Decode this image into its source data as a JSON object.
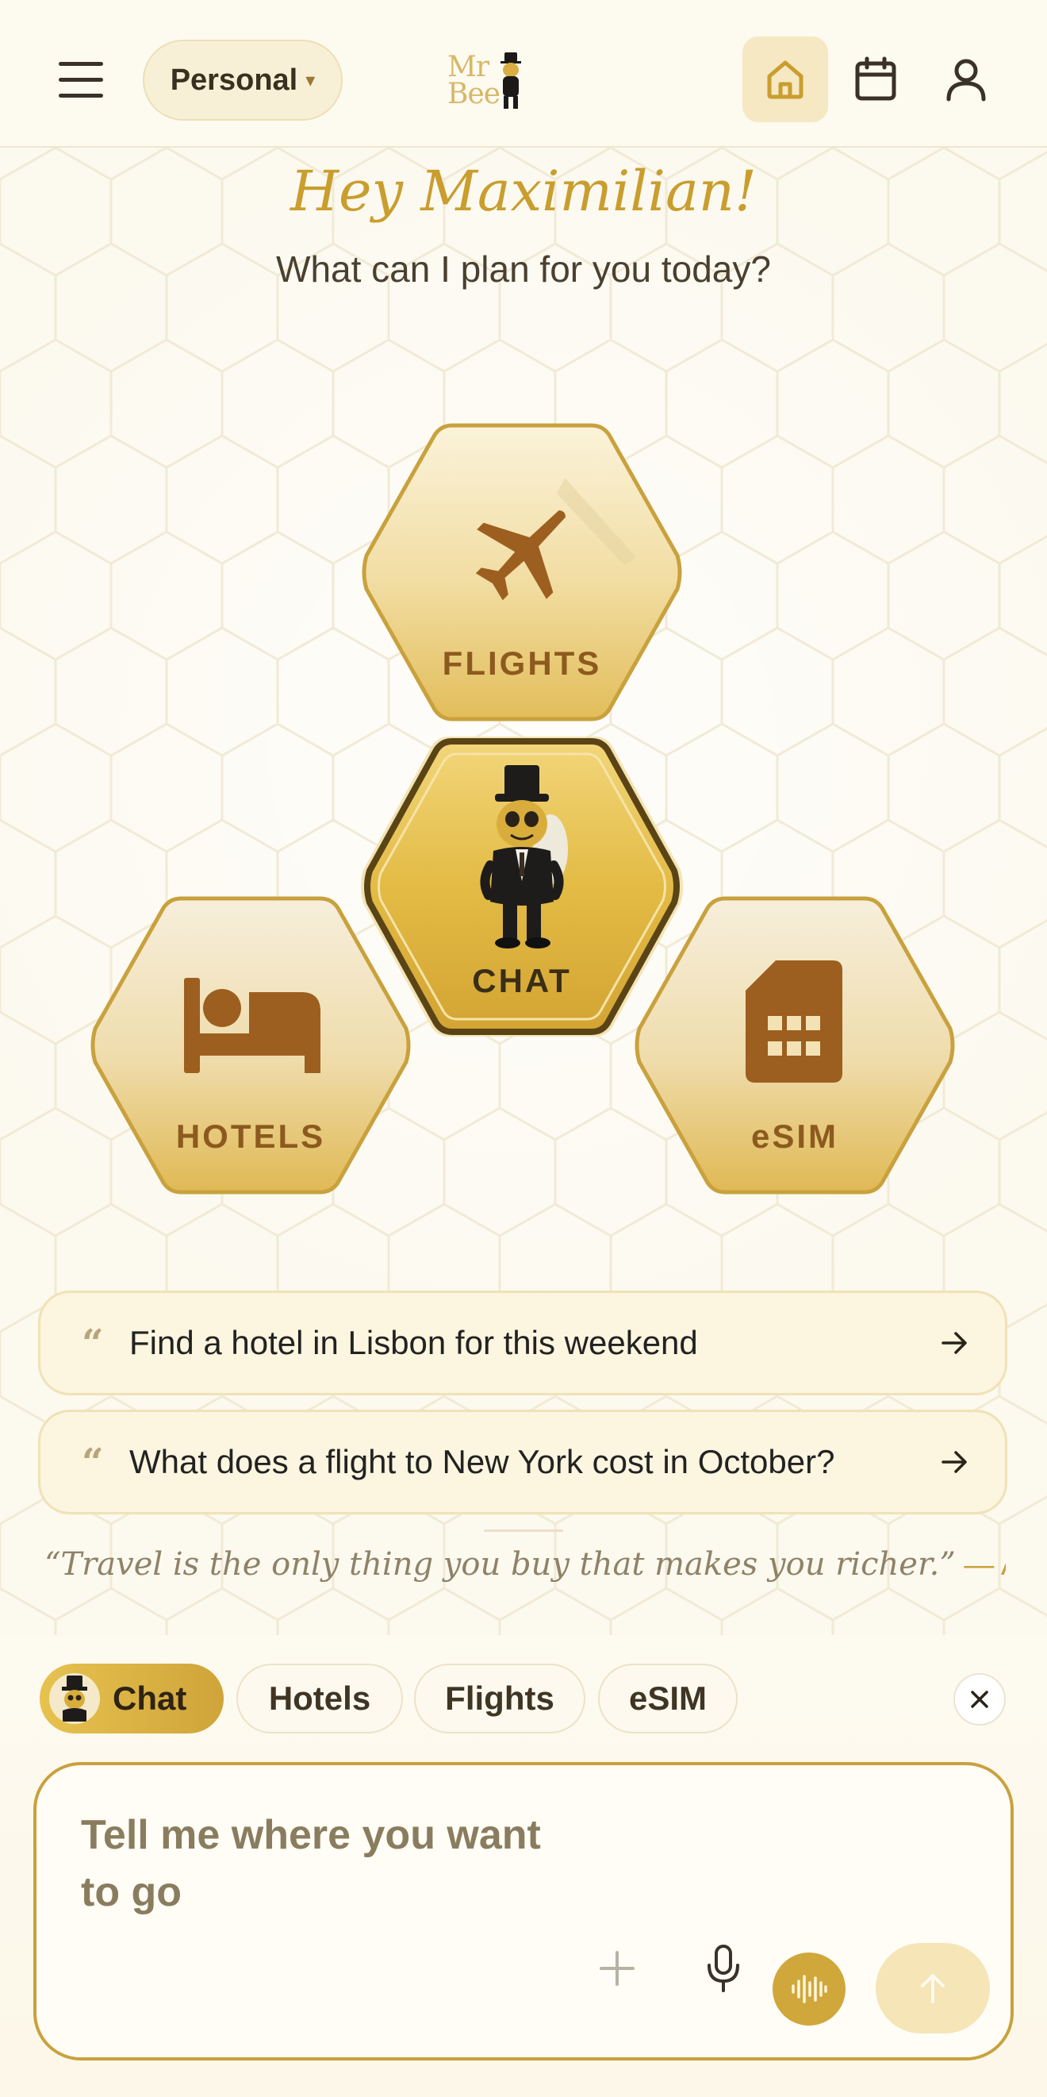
{
  "header": {
    "menu_icon": "hamburger-icon",
    "profile": "Personal",
    "profile_caret": "▾",
    "logo_line1": "Mr",
    "logo_line2": "Bee",
    "nav": [
      {
        "icon": "home-icon",
        "active": true
      },
      {
        "icon": "calendar-icon",
        "active": false
      },
      {
        "icon": "user-icon",
        "active": false
      }
    ]
  },
  "greeting": {
    "title": "Hey Maximilian!",
    "subtitle": "What can I plan for you today?"
  },
  "tiles": {
    "flights": {
      "label": "FLIGHTS",
      "icon": "airplane-icon"
    },
    "chat": {
      "label": "CHAT",
      "icon": "bee-butler-mascot"
    },
    "hotels": {
      "label": "HOTELS",
      "icon": "bed-icon"
    },
    "esim": {
      "label": "eSIM",
      "icon": "sim-card-icon"
    }
  },
  "suggestions": [
    {
      "text": "Find a hotel in Lisbon for this weekend"
    },
    {
      "text": "What does a flight to New York cost in October?"
    }
  ],
  "quote": {
    "text": "“Travel is the only thing you buy that makes you richer.”",
    "author": " — Anonym…"
  },
  "chips": {
    "chat": "Chat",
    "hotels": "Hotels",
    "flights": "Flights",
    "esim": "eSIM",
    "active": "Chat"
  },
  "composer": {
    "placeholder": "Tell me where you want\nto go",
    "value": ""
  },
  "colors": {
    "accent": "#c99e2e",
    "tile_text": "#8c5a1e",
    "background": "#fdfaf0"
  }
}
